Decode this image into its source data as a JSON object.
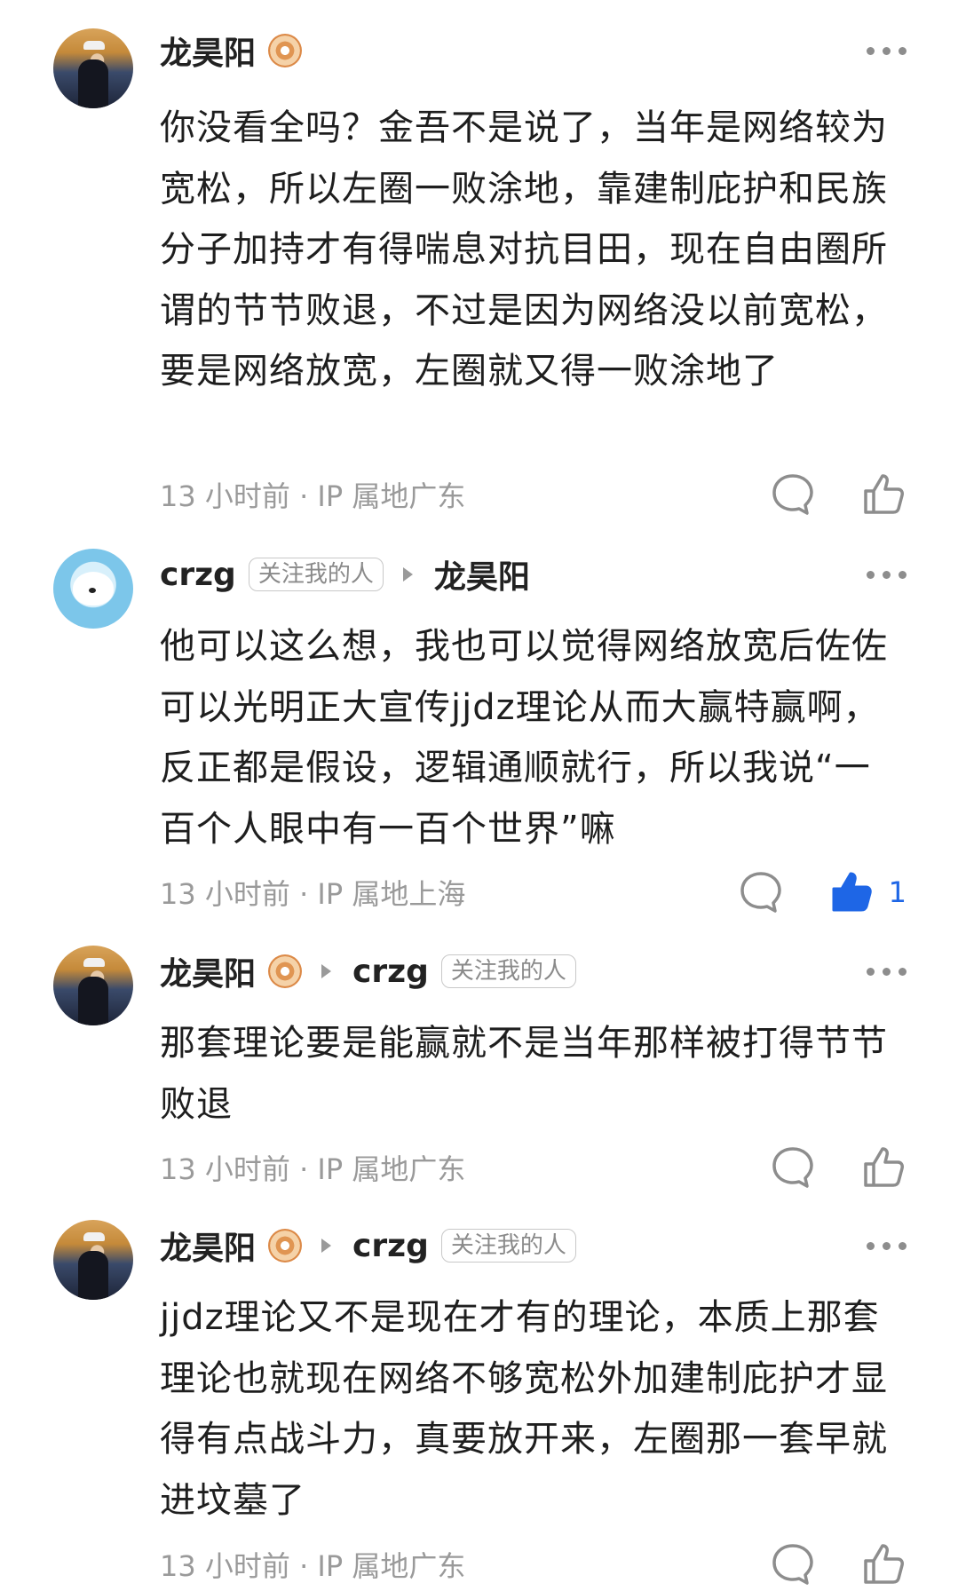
{
  "comments": [
    {
      "author": "龙昊阳",
      "text": "你没看全吗？金吾不是说了，当年是网络较为宽松，所以左圈一败涂地，靠建制庇护和民族分子加持才有得喘息对抗目田，现在自由圈所谓的节节败退，不过是因为网络没以前宽松，要是网络放宽，左圈就又得一败涂地了",
      "meta": "13 小时前 · IP 属地广东"
    },
    {
      "author": "crzg",
      "author_tag": "关注我的人",
      "reply_to": "龙昊阳",
      "text": "他可以这么想，我也可以觉得网络放宽后佐佐可以光明正大宣传jjdz理论从而大赢特赢啊，反正都是假设，逻辑通顺就行，所以我说“一百个人眼中有一百个世界”嘛",
      "meta": "13 小时前 · IP 属地上海",
      "like_count": "1"
    },
    {
      "author": "龙昊阳",
      "reply_to": "crzg",
      "reply_tag": "关注我的人",
      "text": "那套理论要是能赢就不是当年那样被打得节节败退",
      "meta": "13 小时前 · IP 属地广东"
    },
    {
      "author": "龙昊阳",
      "reply_to": "crzg",
      "reply_tag": "关注我的人",
      "text": "jjdz理论又不是现在才有的理论，本质上那套理论也就现在网络不够宽松外加建制庇护才显得有点战斗力，真要放开来，左圈那一套早就进坟墓了",
      "meta": "13 小时前 · IP 属地广东"
    }
  ],
  "colors": {
    "like_active": "#1e66e6",
    "muted": "#9a9a9a"
  },
  "icons": [
    "more-icon",
    "reply-icon",
    "like-icon",
    "arrow-right-icon",
    "medal-icon"
  ]
}
